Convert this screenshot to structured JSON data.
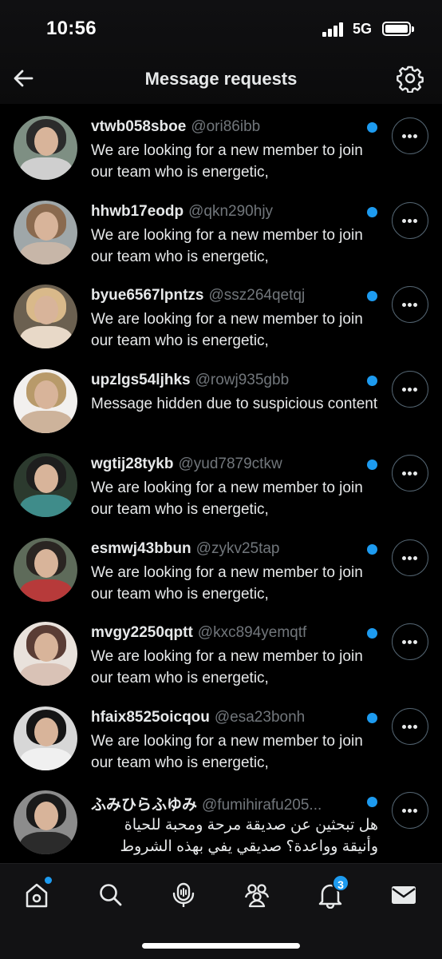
{
  "status_bar": {
    "time": "10:56",
    "network": "5G"
  },
  "header": {
    "title": "Message requests"
  },
  "requests": [
    {
      "name": "vtwb058sboe",
      "handle": "@ori86ibb",
      "preview": "We are looking for a new member to join our team who is energetic,",
      "unread": true,
      "avatar_colors": [
        "#7e8f83",
        "#2b2b2b",
        "#cfcfcf"
      ]
    },
    {
      "name": "hhwb17eodp",
      "handle": "@qkn290hjy",
      "preview": "We are looking for a new member to join our team who is energetic,",
      "unread": true,
      "avatar_colors": [
        "#9fa7a9",
        "#8a6a4f",
        "#c7b6a8"
      ]
    },
    {
      "name": "byue6567lpntzs",
      "handle": "@ssz264qetqj",
      "preview": "We are looking for a new member to join our team who is energetic,",
      "unread": true,
      "avatar_colors": [
        "#6b6050",
        "#d9b98a",
        "#e8d9c8"
      ]
    },
    {
      "name": "upzlgs54ljhks",
      "handle": "@rowj935gbb",
      "preview": "Message hidden due to suspicious content",
      "unread": true,
      "avatar_colors": [
        "#f2f0ee",
        "#b89a6a",
        "#cdb39b"
      ]
    },
    {
      "name": "wgtij28tykb",
      "handle": "@yud7879ctkw",
      "preview": "We are looking for a new member to join our team who is energetic,",
      "unread": true,
      "avatar_colors": [
        "#2c3a2e",
        "#1e1e1e",
        "#3f8c8a"
      ]
    },
    {
      "name": "esmwj43bbun",
      "handle": "@zykv25tap",
      "preview": "We are looking for a new member to join our team who is energetic,",
      "unread": true,
      "avatar_colors": [
        "#5e6b5a",
        "#2a2522",
        "#b73a3a"
      ]
    },
    {
      "name": "mvgy2250qptt",
      "handle": "@kxc894yemqtf",
      "preview": "We are looking for a new member to join our team who is energetic,",
      "unread": true,
      "avatar_colors": [
        "#e9e2dc",
        "#5a3d35",
        "#d9c2b6"
      ]
    },
    {
      "name": "hfaix8525oicqou",
      "handle": "@esa23bonh",
      "preview": "We are looking for a new member to join our team who is energetic,",
      "unread": true,
      "avatar_colors": [
        "#d7d7d7",
        "#151515",
        "#f0f0f0"
      ]
    },
    {
      "name": "ふみひらふゆみ",
      "handle": "@fumihirafu205...",
      "preview": "هل تبحثين عن صديقة مرحة ومحبة للحياة وأنيقة وواعدة؟ صديقي يفي بهذه الشروط",
      "unread": true,
      "rtl": true,
      "avatar_colors": [
        "#8c8c8c",
        "#1a1a1a",
        "#2b2b2b"
      ]
    }
  ],
  "tabbar": {
    "items": [
      {
        "icon": "home-icon"
      },
      {
        "icon": "search-icon"
      },
      {
        "icon": "spaces-icon"
      },
      {
        "icon": "communities-icon"
      },
      {
        "icon": "notifications-icon",
        "badge": "3"
      },
      {
        "icon": "messages-icon"
      }
    ]
  },
  "colors": {
    "accent": "#1d9bf0",
    "background": "#000000",
    "secondary_text": "#71767b"
  }
}
